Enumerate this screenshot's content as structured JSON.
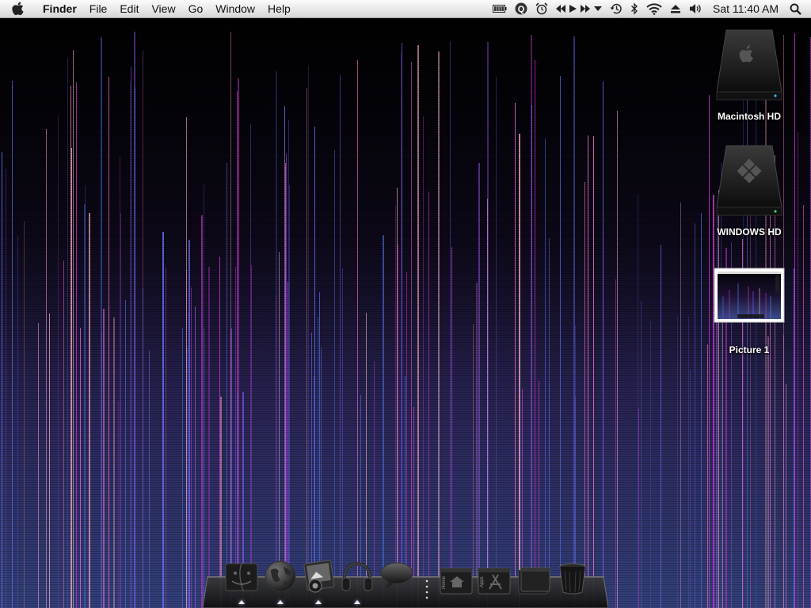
{
  "menubar": {
    "apple_icon": "apple-icon",
    "app_name": "Finder",
    "menus": [
      "File",
      "Edit",
      "View",
      "Go",
      "Window",
      "Help"
    ],
    "status_icons": [
      "battery-icon",
      "quicksilver-icon",
      "alarm-icon",
      "itunes-controls-icon",
      "time-machine-icon",
      "bluetooth-icon",
      "wifi-icon",
      "eject-icon",
      "volume-icon"
    ],
    "clock": "Sat 11:40 AM",
    "spotlight_icon": "spotlight-icon"
  },
  "desktop": {
    "icons": [
      {
        "label": "Macintosh HD",
        "icon": "hard-drive-apple-icon"
      },
      {
        "label": "WINDOWS HD",
        "icon": "hard-drive-windows-icon"
      },
      {
        "label": "Picture 1",
        "icon": "screenshot-thumbnail-icon"
      }
    ]
  },
  "dock": {
    "apps": [
      {
        "name": "finder-icon",
        "running": true
      },
      {
        "name": "globe-browser-icon",
        "running": true
      },
      {
        "name": "photo-app-icon",
        "running": true
      },
      {
        "name": "headphones-icon",
        "running": true
      },
      {
        "name": "speech-bubble-icon",
        "running": false
      }
    ],
    "folders": [
      {
        "name": "home-folder-icon",
        "label": "Home"
      },
      {
        "name": "applications-folder-icon",
        "label": "Apps"
      },
      {
        "name": "stack-folder-icon",
        "label": ""
      },
      {
        "name": "trash-icon",
        "label": ""
      }
    ]
  },
  "colors": {
    "menubar": "#e8e8e8",
    "wallpaper_top": "#000000",
    "wallpaper_bottom": "#33407a",
    "streak_magenta": "#d63ad6",
    "streak_blue": "#6a7bff",
    "streak_pink": "#ffb3c8"
  }
}
